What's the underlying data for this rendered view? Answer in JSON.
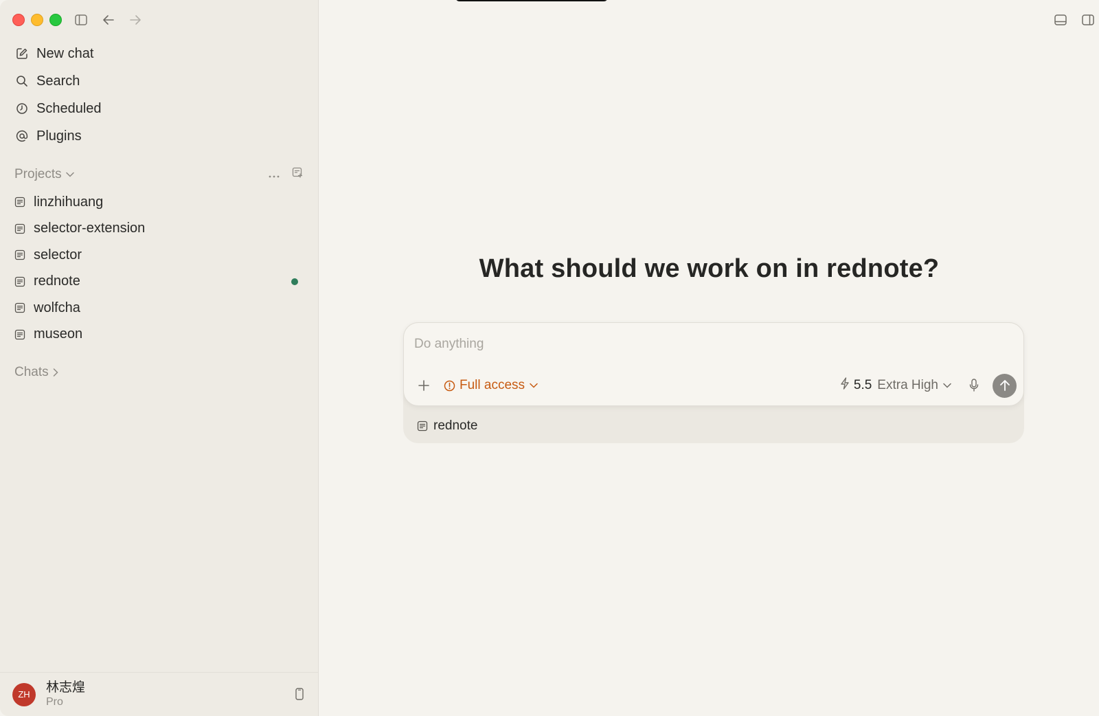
{
  "sidebar": {
    "nav": [
      {
        "label": "New chat",
        "icon": "compose-icon"
      },
      {
        "label": "Search",
        "icon": "search-icon"
      },
      {
        "label": "Scheduled",
        "icon": "clock-icon"
      },
      {
        "label": "Plugins",
        "icon": "at-icon"
      }
    ],
    "projects_label": "Projects",
    "projects": [
      {
        "label": "linzhihuang"
      },
      {
        "label": "selector-extension"
      },
      {
        "label": "selector"
      },
      {
        "label": "rednote",
        "status": "active"
      },
      {
        "label": "wolfcha"
      },
      {
        "label": "museon"
      }
    ],
    "chats_label": "Chats",
    "user": {
      "initials": "ZH",
      "name": "林志煌",
      "plan": "Pro"
    }
  },
  "main": {
    "heading": "What should we work on in rednote?",
    "composer": {
      "placeholder": "Do anything",
      "access_label": "Full access",
      "model_version": "5.5",
      "reasoning_level": "Extra High",
      "project_chip": "rednote"
    }
  },
  "colors": {
    "accent_access": "#c75b12",
    "status_dot": "#2f7d5b",
    "avatar": "#c0392b",
    "send_button": "#8b8985"
  }
}
